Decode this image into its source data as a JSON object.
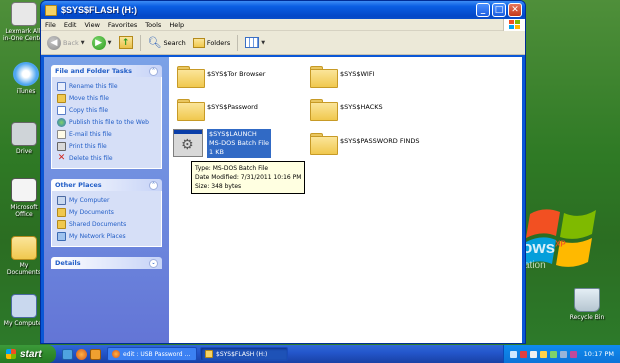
{
  "window": {
    "title": "$SYS$FLASH (H:)",
    "minimize": "_",
    "maximize": "□",
    "close": "✕"
  },
  "menu": [
    "File",
    "Edit",
    "View",
    "Favorites",
    "Tools",
    "Help"
  ],
  "toolbar": {
    "back": "Back",
    "search": "Search",
    "folders": "Folders"
  },
  "tasks": {
    "file_folder_title": "File and Folder Tasks",
    "file_folder_items": [
      "Rename this file",
      "Move this file",
      "Copy this file",
      "Publish this file to the Web",
      "E-mail this file",
      "Print this file",
      "Delete this file"
    ],
    "other_places_title": "Other Places",
    "other_places_items": [
      "My Computer",
      "My Documents",
      "Shared Documents",
      "My Network Places"
    ],
    "details_title": "Details"
  },
  "files": [
    "$SYS$Tor Browser",
    "$SYS$WIFI",
    "$SYS$Password",
    "$SYS$HACKS",
    "$SYS$PASSWORD FINDS"
  ],
  "selected_file": {
    "name": "$SYS$LAUNCH",
    "type": "MS-DOS Batch File",
    "size": "1 KB"
  },
  "tooltip": {
    "type": "Type: MS-DOS Batch File",
    "modified": "Date Modified: 7/31/2011 10:16 PM",
    "size": "Size: 348 bytes"
  },
  "desktop_icons": [
    "Lexmark All-in-One Center",
    "iTunes",
    "Drive",
    "Microsoft Office",
    "My Documents",
    "My Computer"
  ],
  "desktop_brand": {
    "text": "ows",
    "sub": "ation",
    "xp": "XP"
  },
  "recycle_bin": "Recycle Bin",
  "taskbar": {
    "start": "start",
    "tasks": [
      "edit : USB Password ...",
      "$SYS$FLASH (H:)"
    ],
    "clock": "10:17 PM"
  }
}
